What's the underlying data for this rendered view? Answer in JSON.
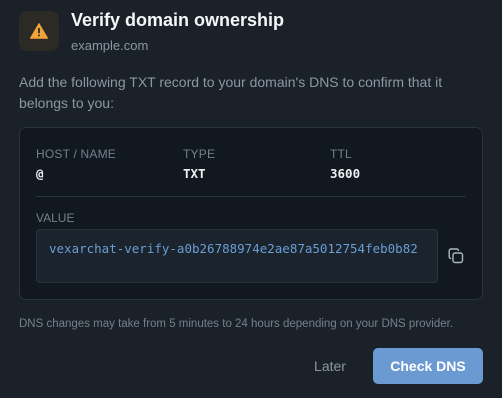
{
  "header": {
    "title": "Verify domain ownership",
    "domain": "example.com",
    "icon": "warning-icon",
    "icon_color": "#f2a43a"
  },
  "description": "Add the following TXT record to your domain's DNS to confirm that it belongs to you:",
  "record": {
    "columns": [
      {
        "label": "HOST / NAME",
        "value": "@"
      },
      {
        "label": "TYPE",
        "value": "TXT"
      },
      {
        "label": "TTL",
        "value": "3600"
      }
    ],
    "value_label": "VALUE",
    "value": "vexarchat-verify-a0b26788974e2ae87a5012754feb0b82",
    "copy_icon": "copy-icon"
  },
  "note": "DNS changes may take from 5 minutes to 24 hours depending on your DNS provider.",
  "actions": {
    "later_label": "Later",
    "check_label": "Check DNS"
  },
  "colors": {
    "background": "#1b2129",
    "card": "#121820",
    "accent": "#6b9ad2",
    "value_text": "#6b9dd6"
  }
}
